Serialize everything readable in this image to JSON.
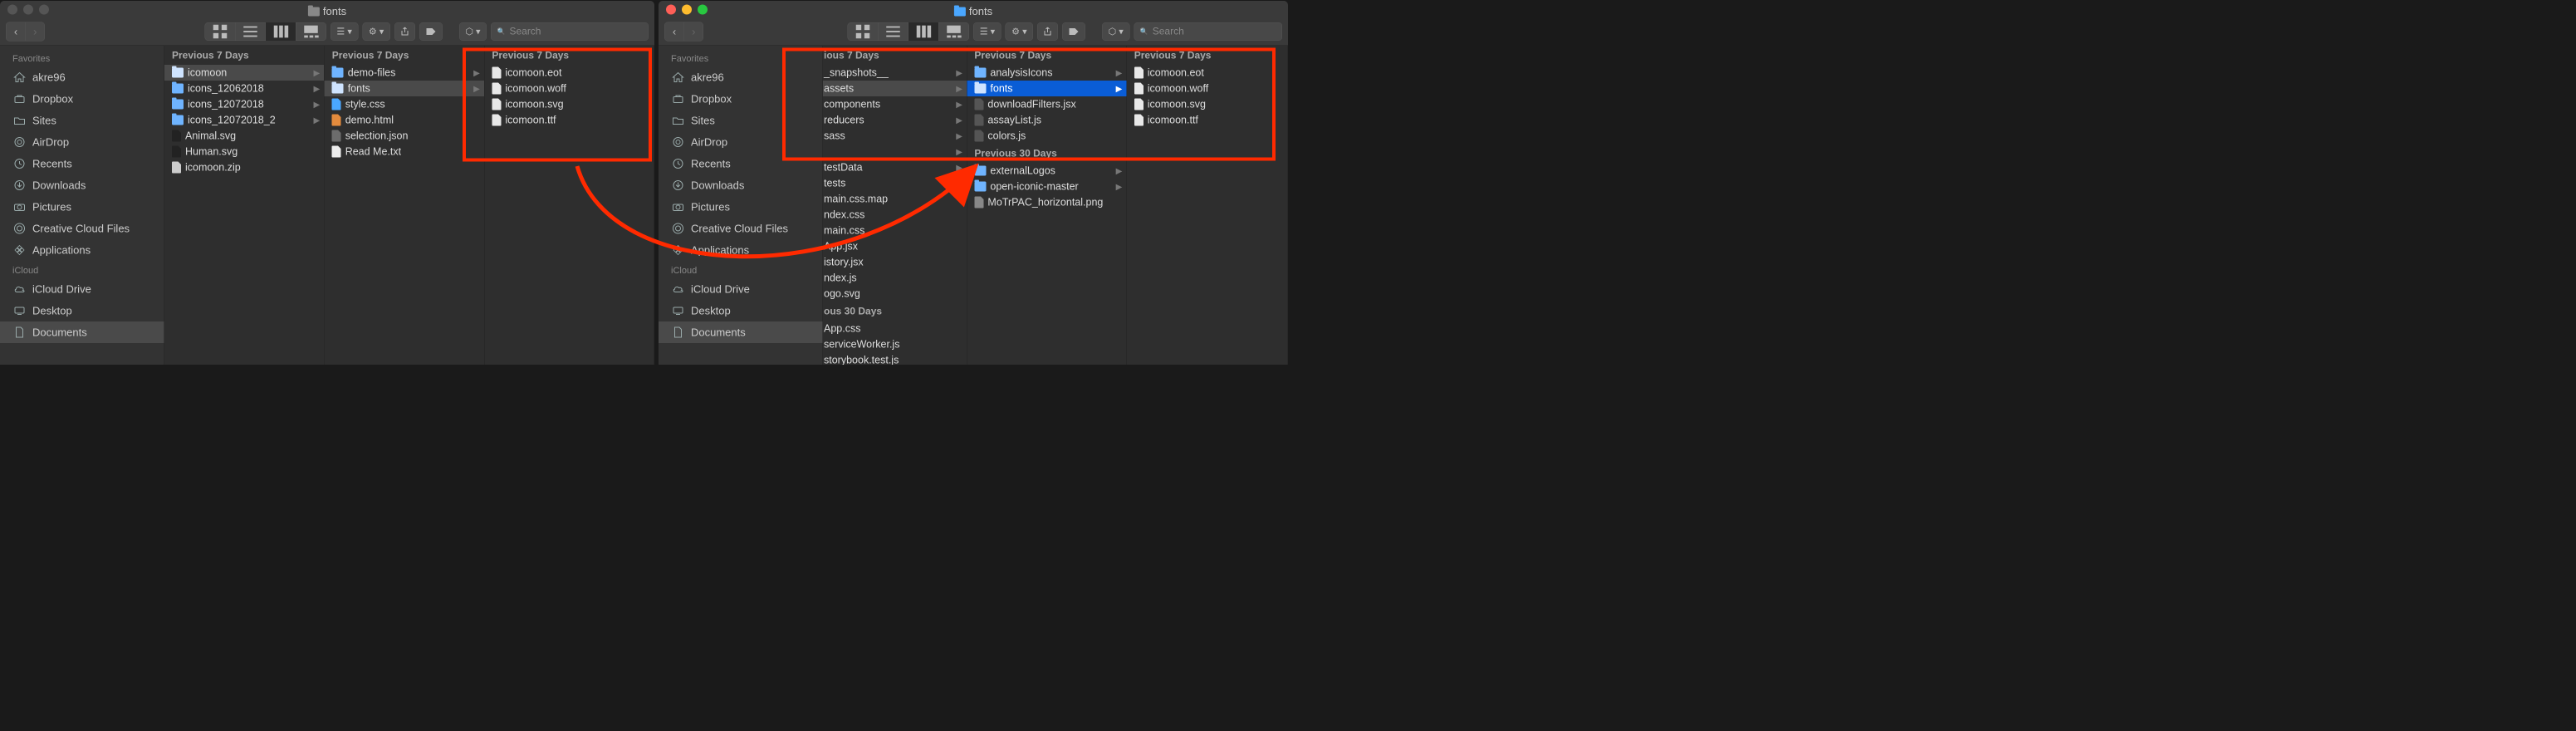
{
  "windowLeft": {
    "title": "fonts",
    "search_placeholder": "Search",
    "sidebar": {
      "favorites_header": "Favorites",
      "favorites": [
        {
          "label": "akre96",
          "icon": "home"
        },
        {
          "label": "Dropbox",
          "icon": "dropbox"
        },
        {
          "label": "Sites",
          "icon": "folder"
        },
        {
          "label": "AirDrop",
          "icon": "airdrop"
        },
        {
          "label": "Recents",
          "icon": "clock"
        },
        {
          "label": "Downloads",
          "icon": "download"
        },
        {
          "label": "Pictures",
          "icon": "camera"
        },
        {
          "label": "Creative Cloud Files",
          "icon": "cc"
        },
        {
          "label": "Applications",
          "icon": "apps"
        }
      ],
      "icloud_header": "iCloud",
      "icloud": [
        {
          "label": "iCloud Drive",
          "icon": "cloud"
        },
        {
          "label": "Desktop",
          "icon": "desktop"
        },
        {
          "label": "Documents",
          "icon": "doc",
          "selected": true
        }
      ]
    },
    "columns": [
      {
        "header": "Previous 7 Days",
        "items": [
          {
            "name": "icomoon",
            "type": "folder",
            "hasChildren": true,
            "selected": "dim"
          },
          {
            "name": "icons_12062018",
            "type": "folder",
            "hasChildren": true
          },
          {
            "name": "icons_12072018",
            "type": "folder",
            "hasChildren": true
          },
          {
            "name": "icons_12072018_2",
            "type": "folder",
            "hasChildren": true
          },
          {
            "name": "Animal.svg",
            "type": "svg"
          },
          {
            "name": "Human.svg",
            "type": "svg"
          },
          {
            "name": "icomoon.zip",
            "type": "zip"
          }
        ]
      },
      {
        "header": "Previous 7 Days",
        "items": [
          {
            "name": "demo-files",
            "type": "folder",
            "hasChildren": true
          },
          {
            "name": "fonts",
            "type": "folder",
            "hasChildren": true,
            "selected": "dim"
          },
          {
            "name": "style.css",
            "type": "css"
          },
          {
            "name": "demo.html",
            "type": "html"
          },
          {
            "name": "selection.json",
            "type": "json"
          },
          {
            "name": "Read Me.txt",
            "type": "txt"
          }
        ]
      },
      {
        "header": "Previous 7 Days",
        "items": [
          {
            "name": "icomoon.eot",
            "type": "file"
          },
          {
            "name": "icomoon.woff",
            "type": "file"
          },
          {
            "name": "icomoon.svg",
            "type": "file"
          },
          {
            "name": "icomoon.ttf",
            "type": "file"
          }
        ]
      }
    ]
  },
  "windowRight": {
    "title": "fonts",
    "search_placeholder": "Search",
    "sidebar": {
      "favorites_header": "Favorites",
      "favorites": [
        {
          "label": "akre96",
          "icon": "home"
        },
        {
          "label": "Dropbox",
          "icon": "dropbox"
        },
        {
          "label": "Sites",
          "icon": "folder"
        },
        {
          "label": "AirDrop",
          "icon": "airdrop"
        },
        {
          "label": "Recents",
          "icon": "clock"
        },
        {
          "label": "Downloads",
          "icon": "download"
        },
        {
          "label": "Pictures",
          "icon": "camera"
        },
        {
          "label": "Creative Cloud Files",
          "icon": "cc"
        },
        {
          "label": "Applications",
          "icon": "apps"
        }
      ],
      "icloud_header": "iCloud",
      "icloud": [
        {
          "label": "iCloud Drive",
          "icon": "cloud"
        },
        {
          "label": "Desktop",
          "icon": "desktop"
        },
        {
          "label": "Documents",
          "icon": "doc",
          "selected": true
        }
      ]
    },
    "columns": [
      {
        "header": "ious 7 Days",
        "clipped": true,
        "items": [
          {
            "name": "_snapshots__",
            "type": "folder",
            "hasChildren": true
          },
          {
            "name": "assets",
            "type": "folder",
            "hasChildren": true,
            "selected": "dim"
          },
          {
            "name": "components",
            "type": "folder",
            "hasChildren": true
          },
          {
            "name": "reducers",
            "type": "folder",
            "hasChildren": true
          },
          {
            "name": "sass",
            "type": "folder",
            "hasChildren": true
          },
          {
            "name": "",
            "type": "folder",
            "hasChildren": true
          },
          {
            "name": "testData",
            "type": "folder",
            "hasChildren": true
          },
          {
            "name": "tests",
            "type": "folder",
            "hasChildren": true
          },
          {
            "name": "main.css.map",
            "type": "file"
          },
          {
            "name": "ndex.css",
            "type": "css"
          },
          {
            "name": "main.css",
            "type": "css"
          },
          {
            "name": "App.jsx",
            "type": "js"
          },
          {
            "name": "istory.jsx",
            "type": "js"
          },
          {
            "name": "ndex.js",
            "type": "js"
          },
          {
            "name": "ogo.svg",
            "type": "svg"
          }
        ],
        "header2": "ous 30 Days",
        "items2": [
          {
            "name": "App.css",
            "type": "css"
          },
          {
            "name": "serviceWorker.js",
            "type": "js"
          },
          {
            "name": "storybook.test.js",
            "type": "js"
          }
        ]
      },
      {
        "header": "Previous 7 Days",
        "items": [
          {
            "name": "analysisIcons",
            "type": "folder",
            "hasChildren": true
          },
          {
            "name": "fonts",
            "type": "folder",
            "hasChildren": true,
            "selected": "active"
          },
          {
            "name": "downloadFilters.jsx",
            "type": "js"
          },
          {
            "name": "assayList.js",
            "type": "js"
          },
          {
            "name": "colors.js",
            "type": "js"
          }
        ],
        "header2": "Previous 30 Days",
        "items2": [
          {
            "name": "externalLogos",
            "type": "folder",
            "hasChildren": true
          },
          {
            "name": "open-iconic-master",
            "type": "folder",
            "hasChildren": true
          },
          {
            "name": "MoTrPAC_horizontal.png",
            "type": "png"
          }
        ]
      },
      {
        "header": "Previous 7 Days",
        "items": [
          {
            "name": "icomoon.eot",
            "type": "file"
          },
          {
            "name": "icomoon.woff",
            "type": "file"
          },
          {
            "name": "icomoon.svg",
            "type": "file"
          },
          {
            "name": "icomoon.ttf",
            "type": "file"
          }
        ]
      }
    ]
  }
}
